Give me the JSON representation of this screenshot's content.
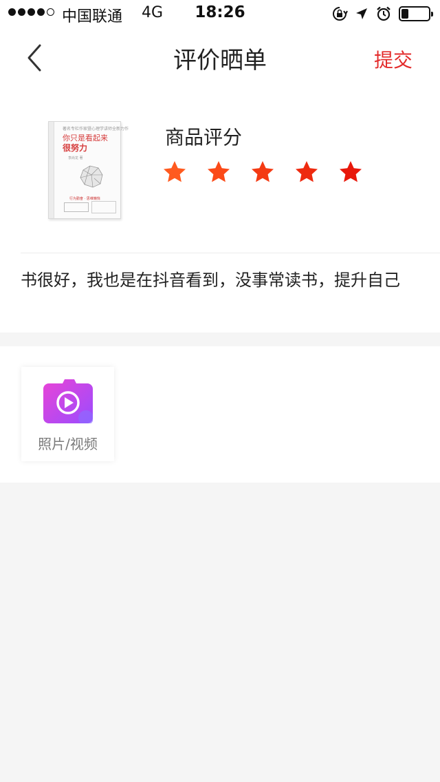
{
  "status_bar": {
    "carrier": "中国联通",
    "network": "4G",
    "time": "18:26",
    "signal_bars_filled": 4,
    "signal_bars_total": 5,
    "battery_level": 0.25
  },
  "nav": {
    "back_icon": "chevron-left-icon",
    "title": "评价晒单",
    "submit_label": "提交"
  },
  "product": {
    "cover": {
      "top_text": "著名专栏作家暨心理学讲师全新力作",
      "title_line1": "你只是看起来",
      "title_line2": "很努力",
      "author": "李尚龙 著",
      "tagline": "行为勤奋 · 思维懒惰"
    },
    "rating_label": "商品评分",
    "rating": 5,
    "rating_max": 5,
    "star_colors": [
      "#ff5a1f",
      "#fb4a18",
      "#f43a13",
      "#ee2a0f",
      "#e8180b"
    ]
  },
  "review": {
    "text": "书很好，我也是在抖音看到，没事常读书，提升自己"
  },
  "media": {
    "add_label": "照片/视频",
    "icon": "camera-play-icon",
    "icon_gradient": [
      "#e944d6",
      "#9a4cff"
    ]
  }
}
